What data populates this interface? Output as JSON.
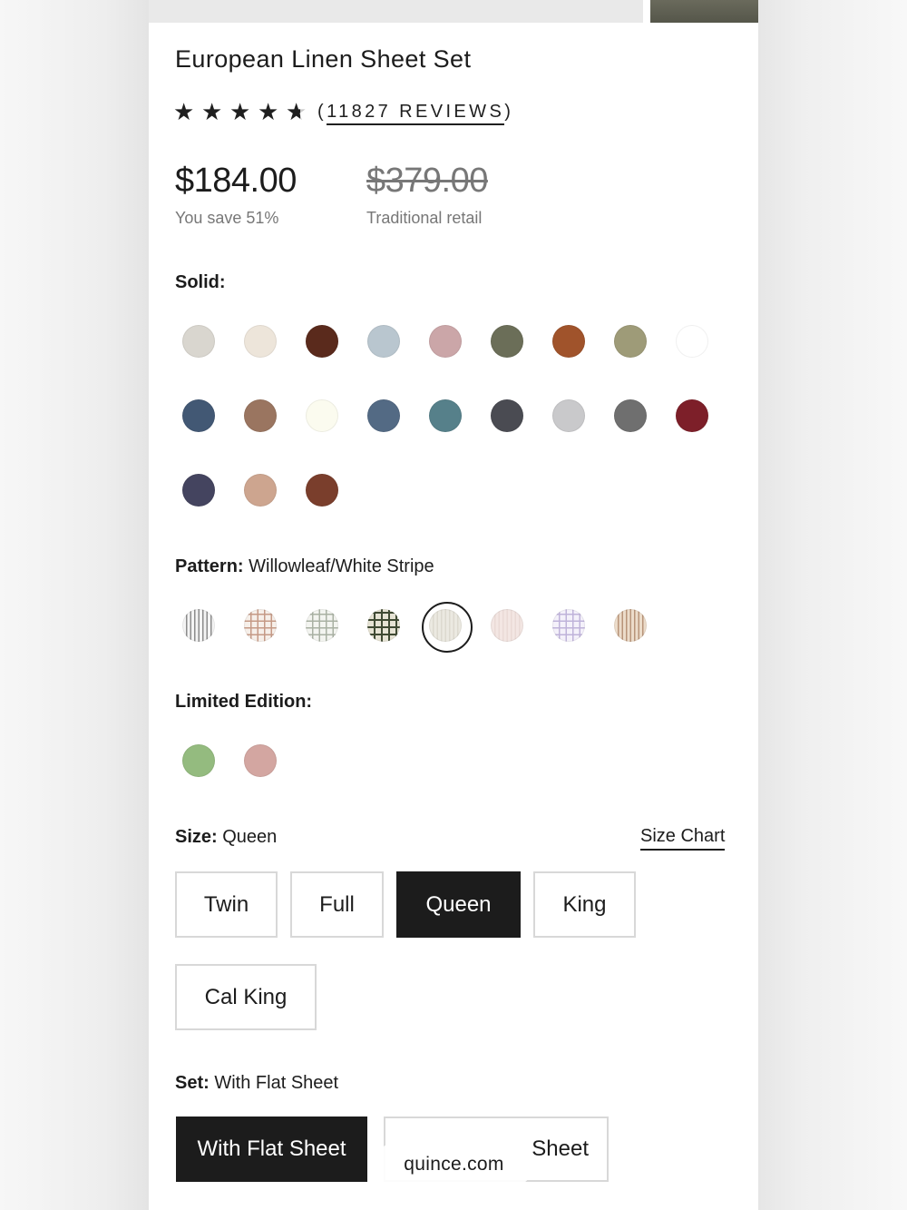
{
  "product": {
    "title": "European Linen Sheet Set",
    "rating_value": 4.5,
    "reviews_open": "(",
    "reviews_text": "11827 REVIEWS",
    "reviews_close": ")",
    "price": "$184.00",
    "savings": "You save 51%",
    "retail_price": "$379.00",
    "retail_label": "Traditional retail"
  },
  "solid": {
    "label": "Solid:",
    "colors": [
      "#d9d6cf",
      "#ede5da",
      "#5a2a1c",
      "#b9c6cf",
      "#cba6a8",
      "#6b6e58",
      "#a0532b",
      "#9e9b78",
      "#ffffff",
      "#425874",
      "#9a7560",
      "#fbfbef",
      "#536a84",
      "#56808a",
      "#4a4b52",
      "#c9c9cb",
      "#6f6f6f",
      "#7d1f29",
      "#44445f",
      "#cda58f",
      "#7a3e2c"
    ]
  },
  "pattern": {
    "label": "Pattern:",
    "value": "Willowleaf/White Stripe",
    "swatches": [
      "stripe-grey",
      "grid-rust",
      "grid-sage",
      "grid-olive",
      "stripe-white",
      "blush-stripe",
      "grid-lavender",
      "stripe-tan"
    ],
    "selected_index": 4
  },
  "limited": {
    "label": "Limited Edition:",
    "colors": [
      "#94bb7f",
      "#d3a6a1"
    ]
  },
  "size": {
    "label": "Size:",
    "value": "Queen",
    "chart_link": "Size Chart",
    "options": [
      "Twin",
      "Full",
      "Queen",
      "King",
      "Cal King"
    ],
    "selected": "Queen"
  },
  "set": {
    "label": "Set:",
    "value": "With Flat Sheet",
    "options": [
      "With Flat Sheet",
      "Without Flat Sheet"
    ],
    "option2_visible": "Sheet",
    "selected": "With Flat Sheet"
  },
  "watermark": "quince.com"
}
